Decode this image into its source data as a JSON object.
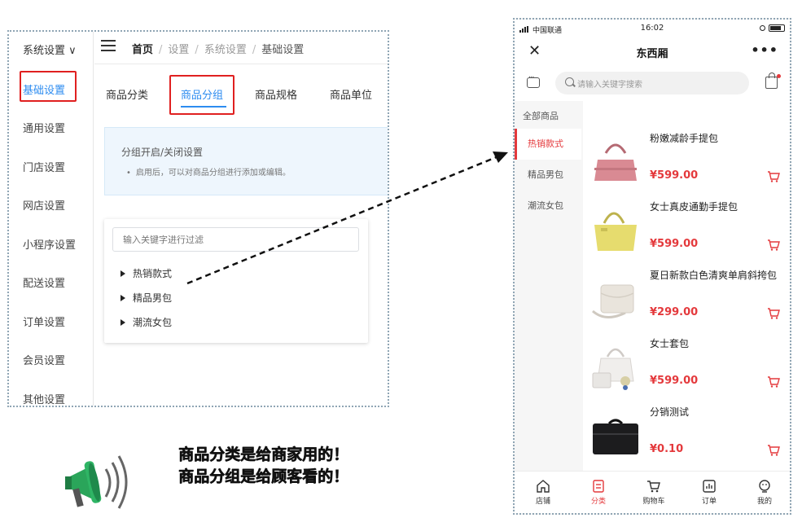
{
  "admin": {
    "sidebar": {
      "system_menu": "系统设置 ∨",
      "items": [
        {
          "label": "基础设置"
        },
        {
          "label": "通用设置"
        },
        {
          "label": "门店设置"
        },
        {
          "label": "网店设置"
        },
        {
          "label": "小程序设置"
        },
        {
          "label": "配送设置"
        },
        {
          "label": "订单设置"
        },
        {
          "label": "会员设置"
        },
        {
          "label": "其他设置"
        }
      ]
    },
    "breadcrumb": {
      "home": "首页",
      "items": [
        "设置",
        "系统设置",
        "基础设置"
      ],
      "separator": "/"
    },
    "tabs": [
      {
        "label": "商品分类"
      },
      {
        "label": "商品分组"
      },
      {
        "label": "商品规格"
      },
      {
        "label": "商品单位"
      }
    ],
    "notice": {
      "title": "分组开启/关闭设置",
      "desc": "启用后，可以对商品分组进行添加或编辑。"
    },
    "tree": {
      "filter_placeholder": "输入关键字进行过滤",
      "nodes": [
        "热销款式",
        "精品男包",
        "潮流女包"
      ]
    }
  },
  "caption": {
    "line1": "商品分类是给商家用的！",
    "line2": "商品分组是给顾客看的！"
  },
  "phone": {
    "status": {
      "carrier": "中国联通",
      "time": "16:02"
    },
    "nav": {
      "title": "东西厢",
      "close": "✕",
      "more": "•••"
    },
    "search_placeholder": "请输入关键字搜索",
    "categories": [
      {
        "label": "全部商品"
      },
      {
        "label": "热销款式"
      },
      {
        "label": "精品男包"
      },
      {
        "label": "潮流女包"
      }
    ],
    "goods": [
      {
        "name": "粉嫩减龄手提包",
        "price": "¥599.00",
        "color": "#d98a93"
      },
      {
        "name": "女士真皮通勤手提包",
        "price": "¥599.00",
        "color": "#e6dc6e"
      },
      {
        "name": "夏日新款白色清爽单肩斜挎包",
        "price": "¥299.00",
        "color": "#e9e4dc"
      },
      {
        "name": "女士套包",
        "price": "¥599.00",
        "color": "#f0eeec"
      },
      {
        "name": "分销测试",
        "price": "¥0.10",
        "color": "#1c1c1e"
      }
    ],
    "tabbar": [
      {
        "label": "店铺"
      },
      {
        "label": "分类"
      },
      {
        "label": "购物车"
      },
      {
        "label": "订单"
      },
      {
        "label": "我的"
      }
    ],
    "accent": "#e4393c"
  }
}
